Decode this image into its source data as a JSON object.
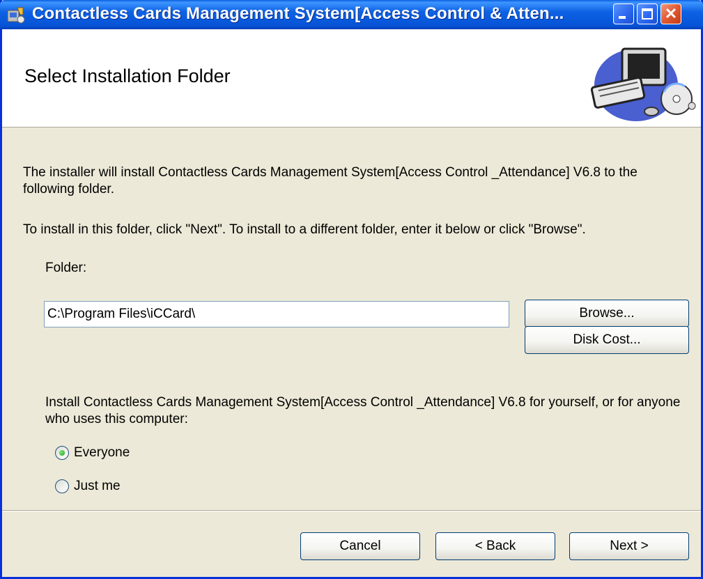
{
  "window": {
    "title": "Contactless Cards Management System[Access Control & Atten...",
    "controls": {
      "minimize": "minimize",
      "maximize": "maximize",
      "close": "✕"
    }
  },
  "banner": {
    "title": "Select Installation Folder",
    "art_icon": "computer-disc-icon"
  },
  "content": {
    "intro": "The installer will install Contactless Cards Management System[Access Control _Attendance] V6.8 to the following folder.",
    "instruction": "To install in this folder, click \"Next\". To install to a different folder, enter it below or click \"Browse\".",
    "folder_label": "Folder:",
    "folder_value": "C:\\Program Files\\iCCard\\",
    "browse_label": "Browse...",
    "disk_cost_label": "Disk Cost...",
    "install_for_text": "Install Contactless Cards Management System[Access Control _Attendance] V6.8 for yourself, or for anyone who uses this computer:",
    "options": [
      {
        "label": "Everyone",
        "selected": true
      },
      {
        "label": "Just me",
        "selected": false
      }
    ]
  },
  "footer": {
    "cancel_label": "Cancel",
    "back_label": "< Back",
    "next_label": "Next >"
  },
  "colors": {
    "title_bar": "#0653d6",
    "face": "#ece9d8",
    "close_button": "#e05a33"
  }
}
